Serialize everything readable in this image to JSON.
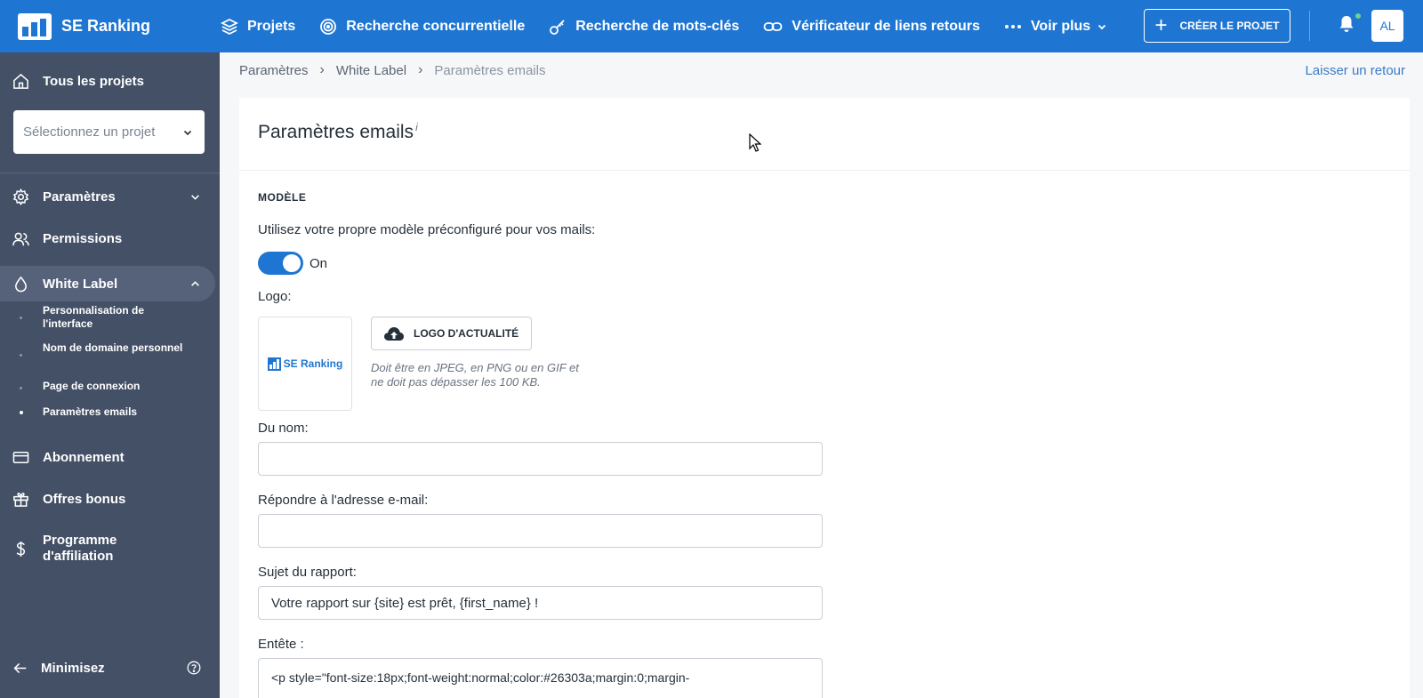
{
  "app": {
    "name": "SE Ranking"
  },
  "topnav": {
    "items": [
      {
        "label": "Projets"
      },
      {
        "label": "Recherche concurrentielle"
      },
      {
        "label": "Recherche de mots-clés"
      },
      {
        "label": "Vérificateur de liens retours"
      },
      {
        "label": "Voir plus"
      }
    ],
    "create_label": "CRÉER LE PROJET",
    "avatar": "AL"
  },
  "sidebar": {
    "all_projects": "Tous les projets",
    "select_placeholder": "Sélectionnez un projet",
    "items": [
      {
        "label": "Paramètres"
      },
      {
        "label": "Permissions"
      },
      {
        "label": "White Label"
      }
    ],
    "sub_items": [
      {
        "label": "Personnalisation de l'interface"
      },
      {
        "label": "Nom de domaine personnel"
      },
      {
        "label": "Page de connexion"
      },
      {
        "label": "Paramètres emails"
      }
    ],
    "bottom_items": [
      {
        "label": "Abonnement"
      },
      {
        "label": "Offres bonus"
      },
      {
        "label": "Programme d'affiliation"
      }
    ],
    "minimize": "Minimisez"
  },
  "breadcrumb": [
    "Paramètres",
    "White Label",
    "Paramètres emails"
  ],
  "feedback": "Laisser un retour",
  "page": {
    "title": "Paramètres emails",
    "info_mark": "i",
    "section": "MODÈLE",
    "template_label": "Utilisez votre propre modèle préconfiguré pour vos mails:",
    "toggle_state": "On",
    "logo_label": "Logo:",
    "logo_text": "SE Ranking",
    "upload_label": "LOGO D'ACTUALITÉ",
    "upload_hint": "Doit être en JPEG, en PNG ou en GIF et ne doit pas dépasser les 100 KB.",
    "from_label": "Du nom:",
    "from_value": "",
    "reply_label": "Répondre à l'adresse e-mail:",
    "reply_value": "",
    "subject_label": "Sujet du rapport:",
    "subject_value": "Votre rapport sur {site} est prêt, {first_name} !",
    "header_label": "Entête :",
    "header_value": "<p style=\"font-size:18px;font-weight:normal;color:#26303a;margin:0;margin-"
  },
  "colors": {
    "primary": "#1f76d2",
    "sidebar": "#435066",
    "toggle_on": "#1f76d2"
  }
}
